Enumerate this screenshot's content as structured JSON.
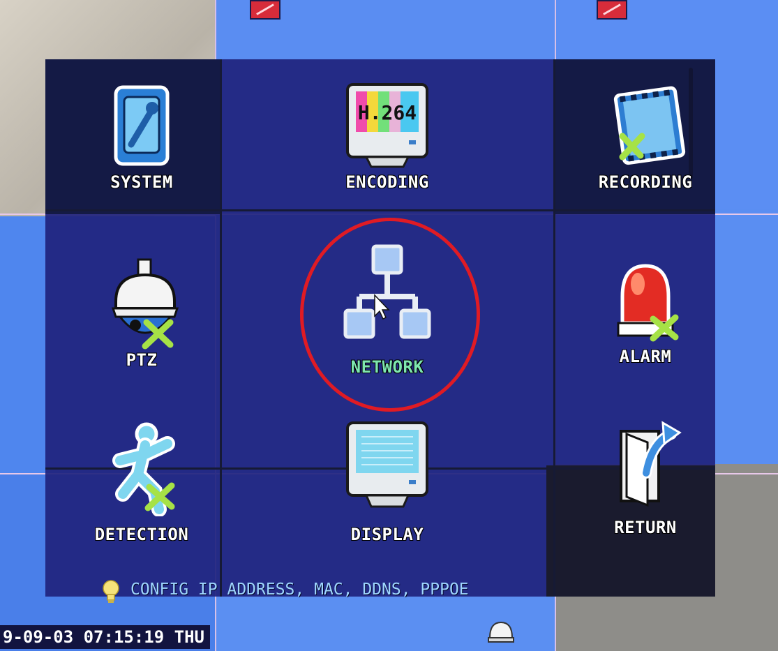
{
  "menu": {
    "items": [
      {
        "label": "SYSTEM",
        "icon": "wrench-panel-icon"
      },
      {
        "label": "ENCODING",
        "icon": "h264-monitor-icon",
        "icon_text": "H.264"
      },
      {
        "label": "RECORDING",
        "icon": "film-reel-icon"
      },
      {
        "label": "PTZ",
        "icon": "dome-camera-icon"
      },
      {
        "label": "NETWORK",
        "icon": "network-topology-icon",
        "selected": true
      },
      {
        "label": "ALARM",
        "icon": "siren-icon"
      },
      {
        "label": "DETECTION",
        "icon": "running-man-icon"
      },
      {
        "label": "DISPLAY",
        "icon": "monitor-icon"
      },
      {
        "label": "RETURN",
        "icon": "exit-door-icon"
      }
    ],
    "hint": "CONFIG IP ADDRESS, MAC, DDNS, PPPOE"
  },
  "status": {
    "timestamp": "9-09-03 07:15:19 THU"
  },
  "colors": {
    "selected_label": "#7ee7b0",
    "panel_bg": "#1f237d",
    "highlight_ring": "#e01b24"
  }
}
